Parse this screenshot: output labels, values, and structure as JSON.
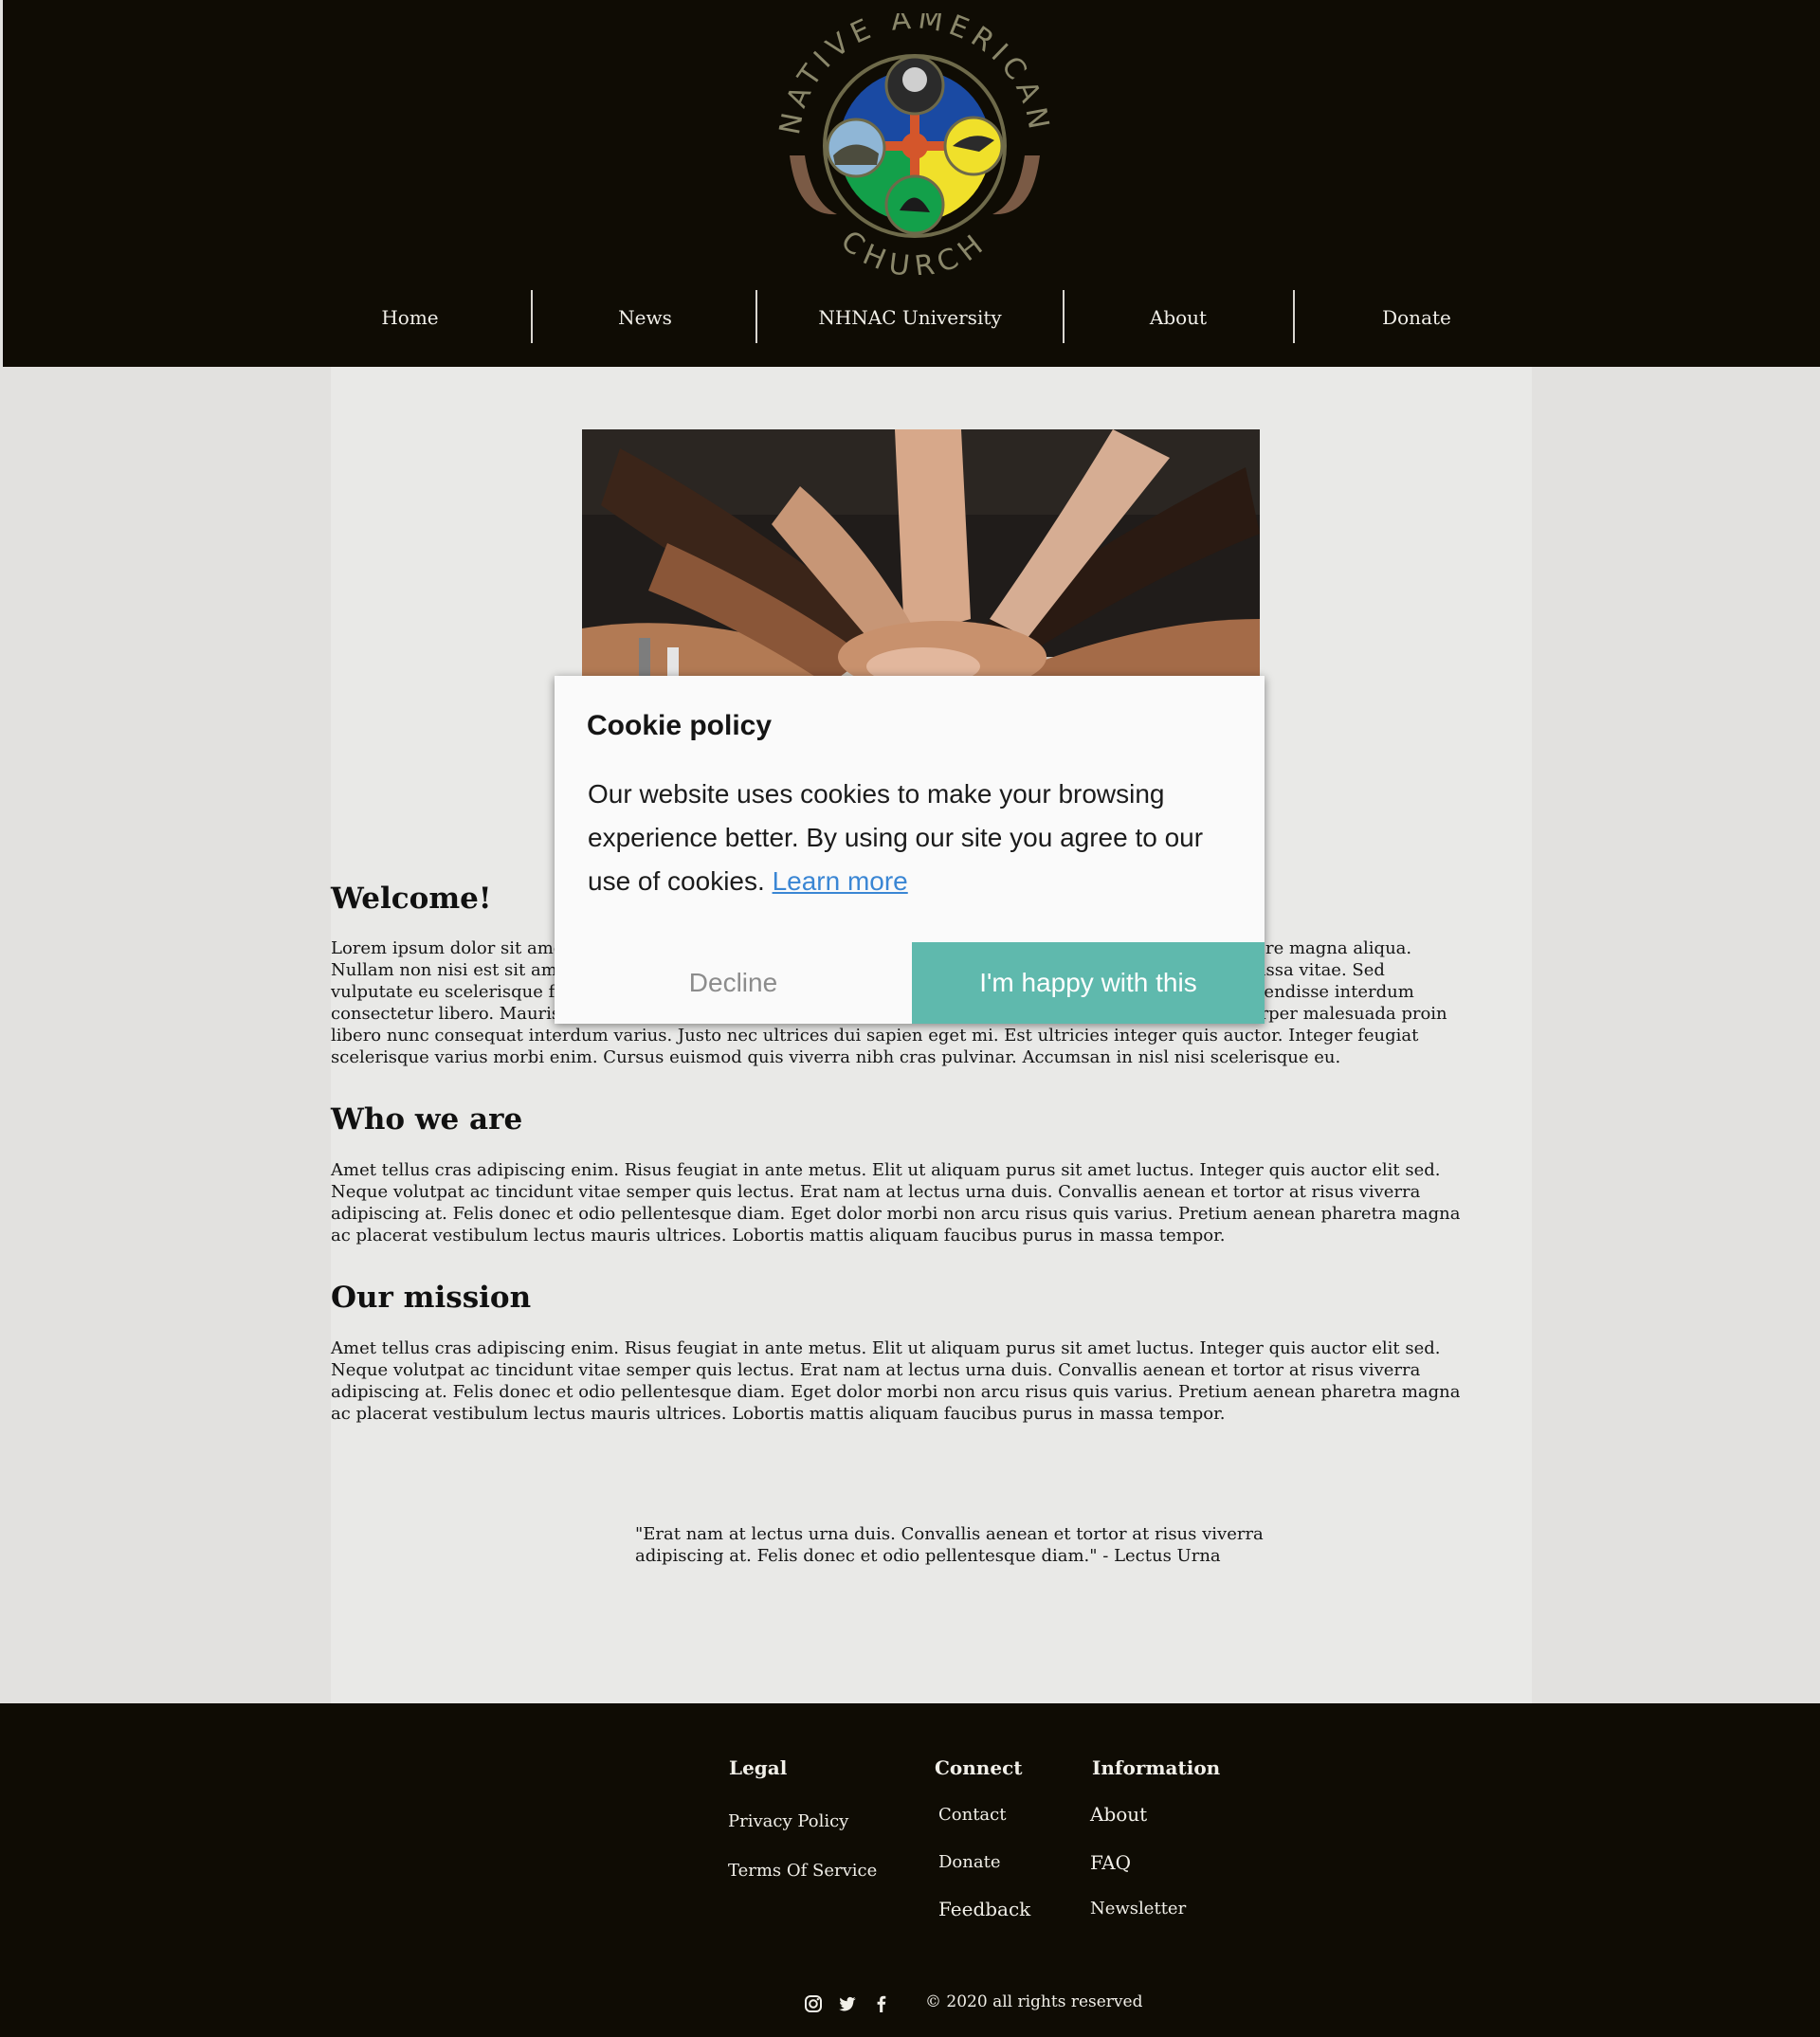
{
  "site": {
    "logo_text_top": "NATIVE AMERICAN",
    "logo_text_bottom": "CHURCH"
  },
  "nav": {
    "items": [
      {
        "label": "Home"
      },
      {
        "label": "News"
      },
      {
        "label": "NHNAC University"
      },
      {
        "label": "About"
      },
      {
        "label": "Donate"
      }
    ]
  },
  "main": {
    "welcome": {
      "heading": "Welcome!",
      "body": "Lorem ipsum dolor sit amet, consectetur adipiscing elit, sed do eiusmod tempor incididunt ut labore et dolore magna aliqua. Nullam non nisi est sit amet facilisis magna etiam tempor orci. Eu volutpat odio facilisis mauris sit amet massa vitae. Sed vulputate eu scelerisque felis imperdiet proin fermentum leo vel orci porta non pulvinar neque laoreet suspendisse interdum consectetur libero. Mauris commodo quis imperdiet massa tincidunt nunc pulvinar sapien et ligula ullamcorper malesuada proin libero nunc consequat interdum varius. Justo nec ultrices dui sapien eget mi. Est ultricies integer quis auctor. Integer feugiat scelerisque varius morbi enim. Cursus euismod quis viverra nibh cras pulvinar. Accumsan in nisl nisi scelerisque eu."
    },
    "who": {
      "heading": "Who we are",
      "body": "Amet tellus cras adipiscing enim. Risus feugiat in ante metus. Elit ut aliquam purus sit amet luctus. Integer quis auctor elit sed. Neque volutpat ac tincidunt vitae semper quis lectus. Erat nam at lectus urna duis. Convallis aenean et tortor at risus viverra adipiscing at. Felis donec et odio pellentesque diam. Eget dolor morbi non arcu risus quis varius. Pretium aenean pharetra magna ac placerat vestibulum lectus mauris ultrices. Lobortis mattis aliquam faucibus purus in massa tempor."
    },
    "mission": {
      "heading": "Our mission",
      "body": "Amet tellus cras adipiscing enim. Risus feugiat in ante metus. Elit ut aliquam purus sit amet luctus. Integer quis auctor elit sed. Neque volutpat ac tincidunt vitae semper quis lectus. Erat nam at lectus urna duis. Convallis aenean et tortor at risus viverra adipiscing at. Felis donec et odio pellentesque diam. Eget dolor morbi non arcu risus quis varius. Pretium aenean pharetra magna ac placerat vestibulum lectus mauris ultrices. Lobortis mattis aliquam faucibus purus in massa tempor."
    },
    "quote": "\"Erat nam at lectus urna duis. Convallis aenean et tortor at risus viverra adipiscing at. Felis donec et odio pellentesque diam.\" - Lectus Urna"
  },
  "cookie": {
    "title": "Cookie policy",
    "text": "Our website uses cookies to make your browsing experience better. By using our site you agree to our use of cookies.",
    "link": "Learn more",
    "decline": "Decline",
    "accept": "I'm happy with this"
  },
  "footer": {
    "legal": {
      "heading": "Legal",
      "links": [
        "Privacy Policy",
        "Terms Of Service"
      ]
    },
    "connect": {
      "heading": "Connect",
      "links": [
        "Contact",
        "Donate",
        "Feedback"
      ]
    },
    "information": {
      "heading": "Information",
      "links": [
        "About",
        "FAQ",
        "Newsletter"
      ]
    },
    "social_icons": [
      "instagram-icon",
      "twitter-icon",
      "facebook-icon"
    ],
    "copyright": "© 2020 all rights reserved"
  },
  "colors": {
    "header_bg": "#0f0c04",
    "accent": "#5fb9ad",
    "link": "#3a86d4"
  }
}
